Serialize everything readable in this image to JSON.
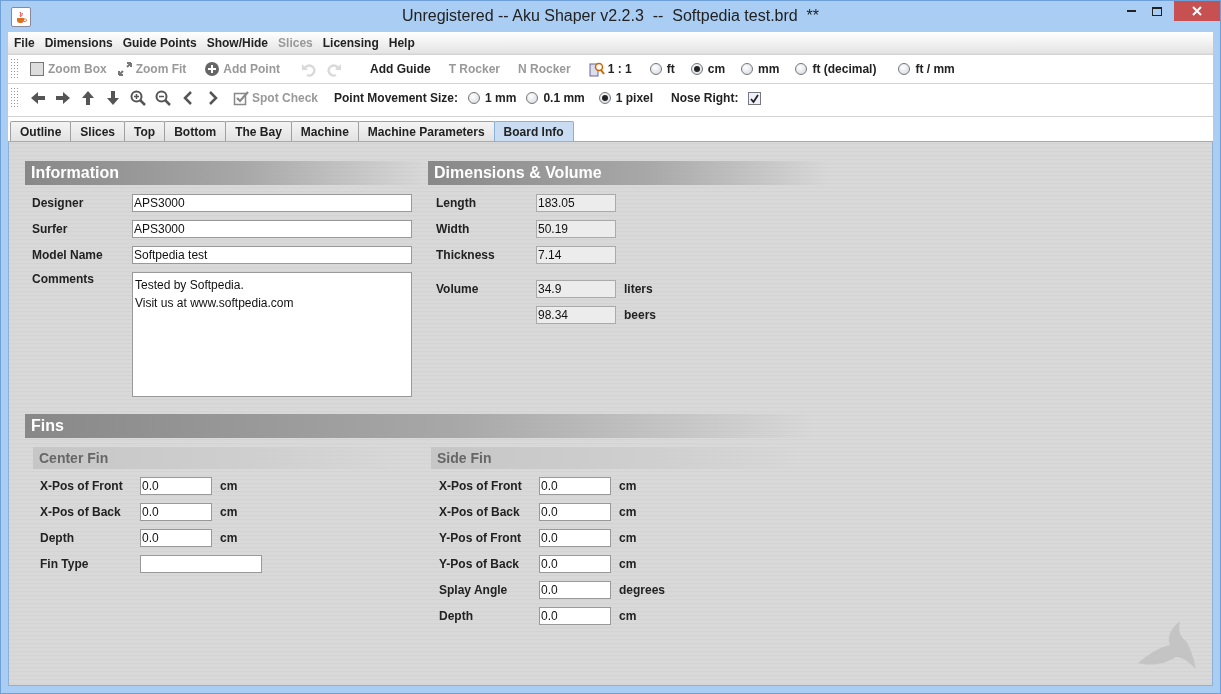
{
  "window": {
    "title": "Unregistered -- Aku Shaper v2.2.3  --  Softpedia test.brd  **"
  },
  "menu": [
    {
      "label": "File",
      "disabled": false
    },
    {
      "label": "Dimensions",
      "disabled": false
    },
    {
      "label": "Guide Points",
      "disabled": false
    },
    {
      "label": "Show/Hide",
      "disabled": false
    },
    {
      "label": "Slices",
      "disabled": true
    },
    {
      "label": "Licensing",
      "disabled": false
    },
    {
      "label": "Help",
      "disabled": false
    }
  ],
  "toolbar_1": [
    {
      "kind": "button",
      "label": "Zoom Box",
      "disabled": true
    },
    {
      "kind": "button",
      "label": "Zoom Fit",
      "disabled": true
    },
    {
      "kind": "button",
      "label": "Add Point",
      "disabled": true
    },
    {
      "kind": "icon",
      "disabled": true
    },
    {
      "kind": "icon",
      "disabled": true
    },
    {
      "kind": "button",
      "label": "Add Guide",
      "disabled": false
    },
    {
      "kind": "button",
      "label": "T Rocker",
      "disabled": true
    },
    {
      "kind": "button",
      "label": "N Rocker",
      "disabled": true
    },
    {
      "kind": "button",
      "label": "1 : 1",
      "disabled": false
    },
    {
      "kind": "radio",
      "label": "ft",
      "selected": false
    },
    {
      "kind": "radio",
      "label": "cm",
      "selected": true
    },
    {
      "kind": "radio",
      "label": "mm",
      "selected": false
    },
    {
      "kind": "radio",
      "label": "ft (decimal)",
      "selected": false
    },
    {
      "kind": "radio",
      "label": "ft / mm",
      "selected": false
    }
  ],
  "toolbar_2": [
    {
      "kind": "icon",
      "disabled": false
    },
    {
      "kind": "icon",
      "disabled": false
    },
    {
      "kind": "icon",
      "disabled": false
    },
    {
      "kind": "icon",
      "disabled": false
    },
    {
      "kind": "icon",
      "disabled": false
    },
    {
      "kind": "icon",
      "disabled": false
    },
    {
      "kind": "icon",
      "disabled": false
    },
    {
      "kind": "icon",
      "disabled": false
    },
    {
      "kind": "button",
      "label": "Spot Check",
      "disabled": true
    },
    {
      "kind": "label",
      "label": "Point Movement Size:"
    },
    {
      "kind": "radio",
      "label": "1 mm",
      "selected": false
    },
    {
      "kind": "radio",
      "label": "0.1 mm",
      "selected": false
    },
    {
      "kind": "radio",
      "label": "1 pixel",
      "selected": true
    },
    {
      "kind": "label",
      "label": "Nose Right:"
    },
    {
      "kind": "checkbox",
      "checked": true
    }
  ],
  "tabs": [
    {
      "label": "Outline",
      "selected": false
    },
    {
      "label": "Slices",
      "selected": false
    },
    {
      "label": "Top",
      "selected": false
    },
    {
      "label": "Bottom",
      "selected": false
    },
    {
      "label": "The Bay",
      "selected": false
    },
    {
      "label": "Machine",
      "selected": false
    },
    {
      "label": "Machine Parameters",
      "selected": false
    },
    {
      "label": "Board Info",
      "selected": true
    }
  ],
  "information": {
    "title": "Information",
    "fields": [
      {
        "kind": "text",
        "label": "Designer",
        "value": "APS3000"
      },
      {
        "kind": "text",
        "label": "Surfer",
        "value": "APS3000"
      },
      {
        "kind": "text",
        "label": "Model Name",
        "value": "Softpedia test"
      },
      {
        "kind": "textarea",
        "label": "Comments",
        "value": "Tested by Softpedia.\nVisit us at www.softpedia.com"
      }
    ]
  },
  "dimensions": {
    "title": "Dimensions & Volume",
    "fields": [
      {
        "label": "Length",
        "value": "183.05"
      },
      {
        "label": "Width",
        "value": "50.19"
      },
      {
        "label": "Thickness",
        "value": "7.14"
      },
      {
        "label": "Volume",
        "value": "34.9",
        "unit": "liters"
      },
      {
        "value": "98.34",
        "unit": "beers"
      }
    ]
  },
  "fins": {
    "title": "Fins",
    "groups": [
      {
        "title": "Center Fin",
        "fields": [
          {
            "label": "X-Pos of Front",
            "value": "0.0",
            "unit": "cm"
          },
          {
            "label": "X-Pos of Back",
            "value": "0.0",
            "unit": "cm"
          },
          {
            "label": "Depth",
            "value": "0.0",
            "unit": "cm"
          },
          {
            "label": "Fin Type",
            "wide": true
          }
        ]
      },
      {
        "title": "Side Fin",
        "fields": [
          {
            "label": "X-Pos of Front",
            "value": "0.0",
            "unit": "cm"
          },
          {
            "label": "X-Pos of Back",
            "value": "0.0",
            "unit": "cm"
          },
          {
            "label": "Y-Pos of Front",
            "value": "0.0",
            "unit": "cm"
          },
          {
            "label": "Y-Pos of Back",
            "value": "0.0",
            "unit": "cm"
          },
          {
            "label": "Splay Angle",
            "value": "0.0",
            "unit": "degrees"
          },
          {
            "label": "Depth",
            "value": "0.0",
            "unit": "cm"
          }
        ]
      }
    ]
  }
}
